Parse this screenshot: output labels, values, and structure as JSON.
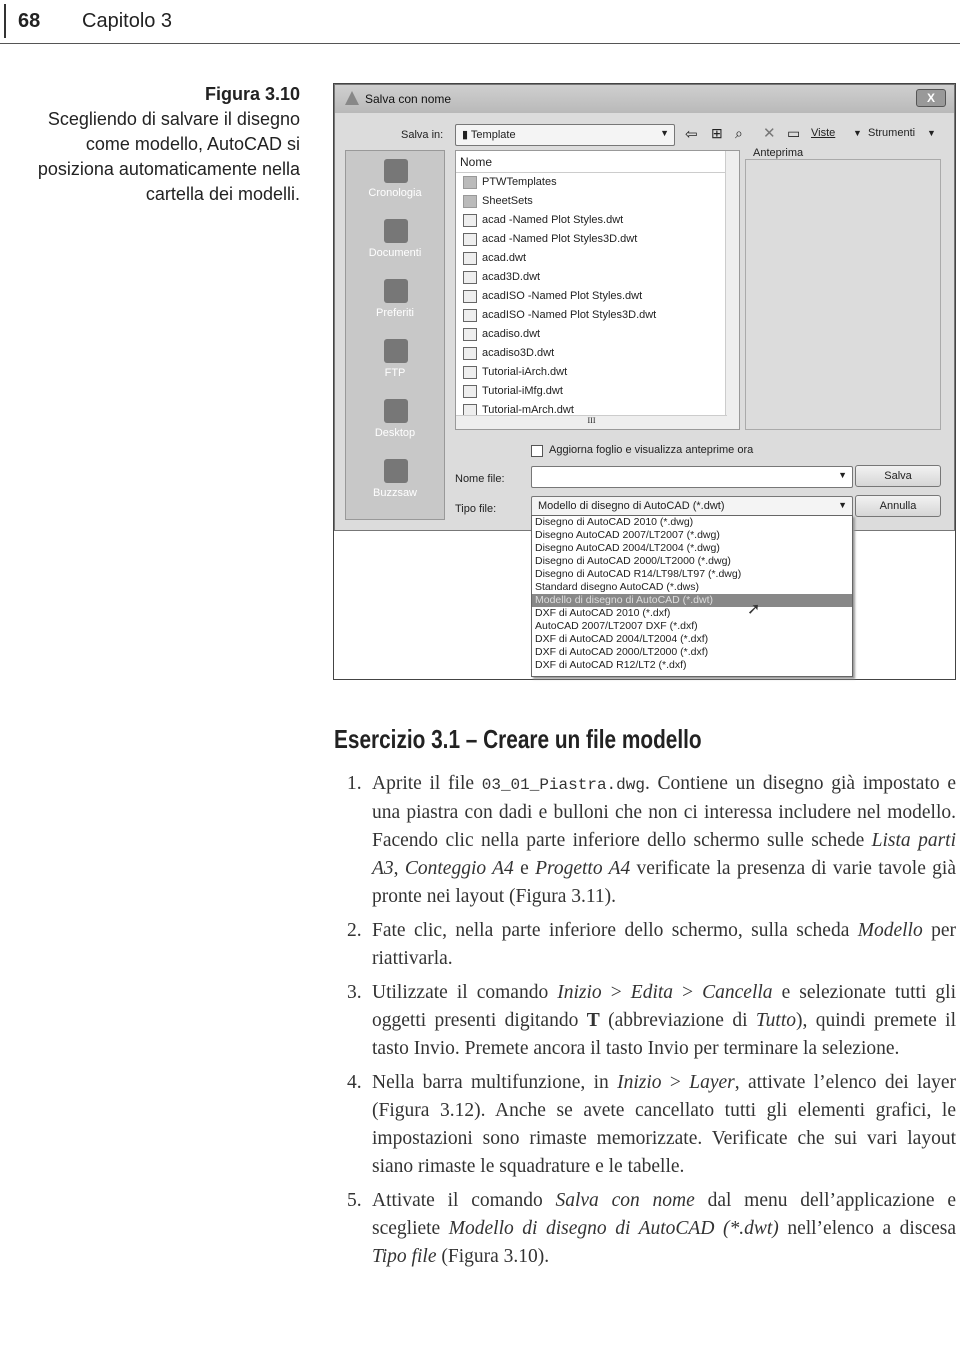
{
  "header": {
    "page_number": "68",
    "chapter": "Capitolo 3"
  },
  "caption": {
    "label": "Figura 3.10",
    "text": "Scegliendo di salvare il disegno come modello, AutoCAD si posiziona automaticamente nella cartella dei modelli."
  },
  "dialog": {
    "title": "Salva con nome",
    "close": "X",
    "save_in_label": "Salva in:",
    "save_in_value": "Template",
    "toolbar": {
      "back_icon": "arrow-left-icon",
      "up_icon": "folder-up-icon",
      "search_icon": "search-web-icon",
      "delete_icon": "delete-icon",
      "new_folder_icon": "new-folder-icon",
      "views": "Viste",
      "tools": "Strumenti"
    },
    "places": [
      "Cronologia",
      "Documenti",
      "Preferiti",
      "FTP",
      "Desktop",
      "Buzzsaw"
    ],
    "list_header": "Nome",
    "files": [
      {
        "name": "PTWTemplates",
        "type": "folder"
      },
      {
        "name": "SheetSets",
        "type": "folder"
      },
      {
        "name": "acad -Named Plot Styles.dwt",
        "type": "dwt"
      },
      {
        "name": "acad -Named Plot Styles3D.dwt",
        "type": "dwt"
      },
      {
        "name": "acad.dwt",
        "type": "dwt"
      },
      {
        "name": "acad3D.dwt",
        "type": "dwt"
      },
      {
        "name": "acadISO -Named Plot Styles.dwt",
        "type": "dwt"
      },
      {
        "name": "acadISO -Named Plot Styles3D.dwt",
        "type": "dwt"
      },
      {
        "name": "acadiso.dwt",
        "type": "dwt"
      },
      {
        "name": "acadiso3D.dwt",
        "type": "dwt"
      },
      {
        "name": "Tutorial-iArch.dwt",
        "type": "dwt"
      },
      {
        "name": "Tutorial-iMfg.dwt",
        "type": "dwt"
      },
      {
        "name": "Tutorial-mArch.dwt",
        "type": "dwt"
      }
    ],
    "preview_label": "Anteprima",
    "checkbox_label": "Aggiorna foglio e visualizza anteprime ora",
    "filename_label": "Nome file:",
    "filename_value": "",
    "filetype_label": "Tipo file:",
    "filetype_value": "Modello di disegno di AutoCAD (*.dwt)",
    "save_button": "Salva",
    "cancel_button": "Annulla",
    "filetype_options": [
      "Disegno di AutoCAD 2010 (*.dwg)",
      "Disegno AutoCAD 2007/LT2007 (*.dwg)",
      "Disegno AutoCAD 2004/LT2004 (*.dwg)",
      "Disegno di AutoCAD 2000/LT2000 (*.dwg)",
      "Disegno di AutoCAD R14/LT98/LT97 (*.dwg)",
      "Standard disegno AutoCAD (*.dws)",
      "Modello di disegno di AutoCAD (*.dwt)",
      "DXF di AutoCAD 2010 (*.dxf)",
      "AutoCAD 2007/LT2007 DXF (*.dxf)",
      "DXF di AutoCAD 2004/LT2004 (*.dxf)",
      "DXF di AutoCAD 2000/LT2000  (*.dxf)",
      "DXF di AutoCAD R12/LT2 (*.dxf)"
    ],
    "selected_option": 6
  },
  "exercise": {
    "title": "Esercizio 3.1 – Creare un file modello",
    "steps": [
      {
        "n": "1.",
        "parts": [
          [
            "t",
            "Aprite il file "
          ],
          [
            "m",
            "03_01_Piastra.dwg"
          ],
          [
            "t",
            ". Contiene un disegno già impostato e una piastra con dadi e bulloni che non ci interessa includere nel modello. Facendo clic nella parte inferiore dello schermo sulle schede "
          ],
          [
            "i",
            "Lista parti A3"
          ],
          [
            "t",
            ", "
          ],
          [
            "i",
            "Conteggio A4"
          ],
          [
            "t",
            " e "
          ],
          [
            "i",
            "Progetto A4"
          ],
          [
            "t",
            " verificate la presenza di varie tavole già pronte nei layout (Figura 3.11)."
          ]
        ]
      },
      {
        "n": "2.",
        "parts": [
          [
            "t",
            "Fate clic, nella parte inferiore dello schermo, sulla scheda "
          ],
          [
            "i",
            "Modello"
          ],
          [
            "t",
            " per riattivarla."
          ]
        ]
      },
      {
        "n": "3.",
        "parts": [
          [
            "t",
            "Utilizzate il comando "
          ],
          [
            "i",
            "Inizio"
          ],
          [
            "t",
            " > "
          ],
          [
            "i",
            "Edita"
          ],
          [
            "t",
            " > "
          ],
          [
            "i",
            "Cancella"
          ],
          [
            "t",
            " e selezionate tutti gli oggetti presenti digitando "
          ],
          [
            "b",
            "T"
          ],
          [
            "t",
            " (abbreviazione di "
          ],
          [
            "i",
            "Tutto"
          ],
          [
            "t",
            "), quindi premete il tasto Invio. Premete ancora il tasto Invio per terminare la selezione."
          ]
        ]
      },
      {
        "n": "4.",
        "parts": [
          [
            "t",
            "Nella barra multifunzione, in "
          ],
          [
            "i",
            "Inizio"
          ],
          [
            "t",
            " > "
          ],
          [
            "i",
            "Layer"
          ],
          [
            "t",
            ", attivate l’elenco dei layer (Figura 3.12). Anche se avete cancellato tutti gli elementi grafici, le impostazioni sono rimaste memorizzate. Verificate che sui vari layout siano rimaste le squadrature e le tabelle."
          ]
        ]
      },
      {
        "n": "5.",
        "parts": [
          [
            "t",
            "Attivate il comando "
          ],
          [
            "i",
            "Salva con nome"
          ],
          [
            "t",
            " dal menu dell’applicazione e scegliete "
          ],
          [
            "i",
            "Modello di disegno di AutoCAD (*.dwt)"
          ],
          [
            "t",
            " nell’elenco a discesa "
          ],
          [
            "i",
            "Tipo file"
          ],
          [
            "t",
            " (Figura 3.10)."
          ]
        ]
      }
    ]
  }
}
